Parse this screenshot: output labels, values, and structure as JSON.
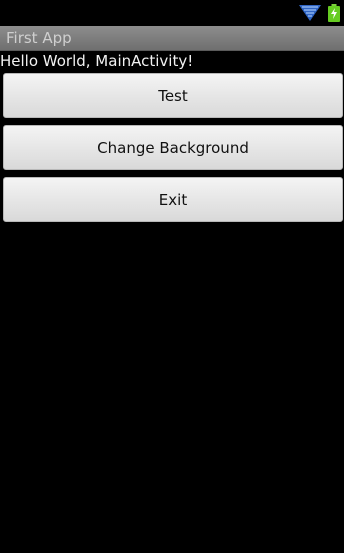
{
  "app_bar": {
    "title": "First App"
  },
  "content": {
    "hello_text": "Hello World, MainActivity!"
  },
  "buttons": [
    {
      "label": "Test"
    },
    {
      "label": "Change Background"
    },
    {
      "label": "Exit"
    }
  ],
  "status_bar": {
    "icons": [
      "wifi-icon",
      "battery-charging-icon"
    ]
  },
  "colors": {
    "screen_background": "#000000",
    "title_bar": "#7f7f7f",
    "button_face": "#e8e8e8",
    "wifi": "#3b6dc9",
    "battery": "#66cc22"
  }
}
